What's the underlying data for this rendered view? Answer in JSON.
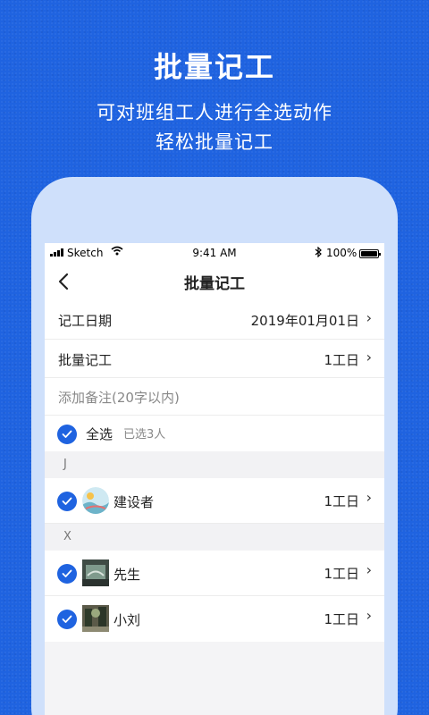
{
  "promo": {
    "title": "批量记工",
    "subtitle_line1": "可对班组工人进行全选动作",
    "subtitle_line2": "轻松批量记工"
  },
  "status_bar": {
    "carrier": "Sketch",
    "time": "9:41 AM",
    "battery": "100%",
    "bluetooth_icon": "bluetooth-icon",
    "wifi_icon": "wifi-icon"
  },
  "nav": {
    "title": "批量记工",
    "back_icon": "chevron-left-icon"
  },
  "form": {
    "date_label": "记工日期",
    "date_value": "2019年01月01日",
    "batch_label": "批量记工",
    "batch_value": "1工日",
    "note_placeholder": "添加备注(20字以内)"
  },
  "select_all": {
    "label": "全选",
    "count": "已选3人"
  },
  "groups": [
    {
      "letter": "J",
      "workers": [
        {
          "name": "建设者",
          "value": "1工日",
          "checked": true
        }
      ]
    },
    {
      "letter": "X",
      "workers": [
        {
          "name": "先生",
          "value": "1工日",
          "checked": true
        },
        {
          "name": "小刘",
          "value": "1工日",
          "checked": true
        }
      ]
    }
  ],
  "colors": {
    "brand_blue": "#1f63e0",
    "frame": "#cfe0fb"
  }
}
